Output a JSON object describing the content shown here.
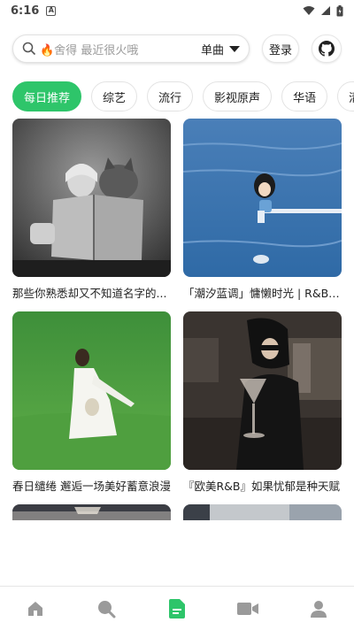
{
  "status_bar": {
    "time": "6:16",
    "notification_letter": "A"
  },
  "search": {
    "placeholder": "🔥舍得 最近很火哦",
    "type_selected": "单曲"
  },
  "header": {
    "login_label": "登录"
  },
  "chips": [
    "每日推荐",
    "综艺",
    "流行",
    "影视原声",
    "华语",
    "清晨"
  ],
  "cards": [
    {
      "title": "那些你熟悉却又不知道名字的..."
    },
    {
      "title": "「潮汐蓝调」慵懒时光 | R&B ..."
    },
    {
      "title": "春日缱绻 邂逅一场美好蓄意浪漫"
    },
    {
      "title": "『欧美R&B』如果忧郁是种天赋"
    }
  ],
  "colors": {
    "accent": "#2ec56a",
    "icon_inactive": "#9a9a9a"
  },
  "bottom_nav": [
    "home-icon",
    "search-icon",
    "playlist-icon",
    "video-icon",
    "profile-icon"
  ],
  "bottom_nav_active": "playlist-icon"
}
